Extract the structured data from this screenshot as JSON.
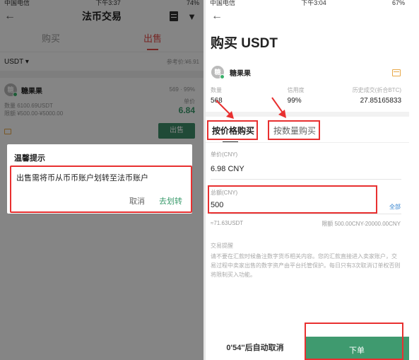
{
  "left": {
    "statusbar": {
      "carrier": "中国电信",
      "time": "下午3:37",
      "battery": "74%"
    },
    "nav": {
      "title": "法币交易"
    },
    "tabs": [
      {
        "label": "购买"
      },
      {
        "label": "出售"
      }
    ],
    "filter": {
      "coin": "USDT",
      "ref_price": "参考价:¥6.91"
    },
    "order": {
      "merchant": "糖果果",
      "avatar_text": "糖",
      "stats": "569 · 99%",
      "quantity": "数量 6100.69USDT",
      "limit": "限额 ¥500.00-¥5000.00",
      "price_label": "单价",
      "price": "6.84",
      "sell_button": "出售"
    },
    "dialog": {
      "title": "温馨提示",
      "message": "出售需将币从币币账户划转至法币账户",
      "cancel": "取消",
      "confirm": "去划转"
    }
  },
  "right": {
    "statusbar": {
      "carrier": "中国电信",
      "time": "下午3:04",
      "battery": "67%"
    },
    "title": "购买 USDT",
    "merchant": {
      "name": "糖果果",
      "avatar_text": "糖"
    },
    "stats": {
      "labels": [
        "数量",
        "信用度",
        "历史成交(折合BTC)"
      ],
      "values": [
        "568",
        "99%",
        "27.85165833"
      ]
    },
    "tabs": [
      {
        "label": "按价格购买"
      },
      {
        "label": "按数量购买"
      }
    ],
    "unit_price": {
      "label": "单价(CNY)",
      "value": "6.98 CNY"
    },
    "amount": {
      "label": "总额(CNY)",
      "value": "500",
      "all_button": "全部"
    },
    "hint": {
      "estimate": "≈71.63USDT",
      "limit": "限额 500.00CNY-20000.00CNY"
    },
    "tips": {
      "title": "交易提醒",
      "body": "请不要在汇款时候备注数字货币相关内容。您的汇款直接进入卖家账户，交易过程中卖家出售的数字资产由平台托管保护。每日只有3次取消订单权否则将限制买入功能。"
    },
    "bottom": {
      "countdown": "0'54''后自动取消",
      "order_button": "下单"
    }
  },
  "colors": {
    "sell_red": "#e24b48",
    "buy_green": "#3f9a6f",
    "annotation_red": "#e83030",
    "link_blue": "#2e7fce"
  }
}
